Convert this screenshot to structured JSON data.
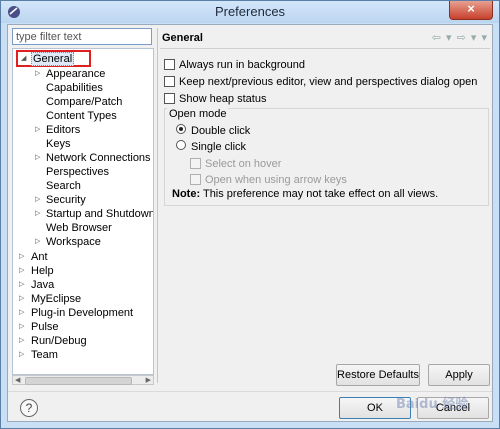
{
  "window": {
    "title": "Preferences",
    "close_label": "×"
  },
  "filter": {
    "placeholder": "type filter text",
    "value": ""
  },
  "tree": {
    "general": {
      "label": "General",
      "twisty": "◢"
    },
    "general_children": [
      {
        "label": "Appearance",
        "expandable": true
      },
      {
        "label": "Capabilities",
        "expandable": false
      },
      {
        "label": "Compare/Patch",
        "expandable": false
      },
      {
        "label": "Content Types",
        "expandable": false
      },
      {
        "label": "Editors",
        "expandable": true
      },
      {
        "label": "Keys",
        "expandable": false
      },
      {
        "label": "Network Connections",
        "expandable": true
      },
      {
        "label": "Perspectives",
        "expandable": false
      },
      {
        "label": "Search",
        "expandable": false
      },
      {
        "label": "Security",
        "expandable": true
      },
      {
        "label": "Startup and Shutdown",
        "expandable": true
      },
      {
        "label": "Web Browser",
        "expandable": false
      },
      {
        "label": "Workspace",
        "expandable": true
      }
    ],
    "top_level": [
      {
        "label": "Ant"
      },
      {
        "label": "Help"
      },
      {
        "label": "Java"
      },
      {
        "label": "MyEclipse"
      },
      {
        "label": "Plug-in Development"
      },
      {
        "label": "Pulse"
      },
      {
        "label": "Run/Debug"
      },
      {
        "label": "Team"
      }
    ]
  },
  "page": {
    "title": "General",
    "nav_icons": "⇦ ▾ ⇨ ▾ ▾",
    "checkboxes": [
      {
        "label": "Always run in background",
        "checked": false
      },
      {
        "label": "Keep next/previous editor, view and perspectives dialog open",
        "checked": false
      },
      {
        "label": "Show heap status",
        "checked": false
      }
    ],
    "open_mode": {
      "group_label": "Open mode",
      "double_click": "Double click",
      "single_click": "Single click",
      "selected": "double_click",
      "select_on_hover": "Select on hover",
      "open_arrow_keys": "Open when using arrow keys"
    },
    "note_label": "Note:",
    "note_text": "This preference may not take effect on all views."
  },
  "buttons": {
    "restore_defaults": "Restore Defaults",
    "apply": "Apply",
    "ok": "OK",
    "cancel": "Cancel",
    "help": "?"
  },
  "watermark": "Baidu 经验"
}
